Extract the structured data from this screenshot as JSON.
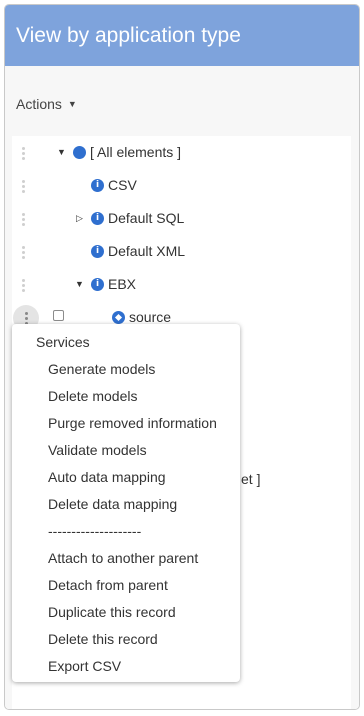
{
  "header": {
    "title": "View by application type"
  },
  "toolbar": {
    "actions_label": "Actions"
  },
  "tree": {
    "items": [
      {
        "label": "[ All elements ]"
      },
      {
        "label": "CSV"
      },
      {
        "label": "Default SQL"
      },
      {
        "label": "Default XML"
      },
      {
        "label": "EBX"
      },
      {
        "label": "source"
      }
    ],
    "partially_hidden_text": "et ]"
  },
  "context_menu": {
    "title": "Services",
    "items": [
      "Generate models",
      "Delete models",
      "Purge removed information",
      "Validate models",
      "Auto data mapping",
      "Delete data mapping",
      "--------------------",
      "Attach to another parent",
      "Detach from parent",
      "Duplicate this record",
      "Delete this record",
      "Export CSV"
    ]
  },
  "icons": {
    "drag_handle": "drag-handle-icon",
    "info": "info-icon",
    "dot": "dot-icon",
    "diamond": "diamond-icon"
  },
  "colors": {
    "header_bg": "#7ea3dc",
    "icon_blue": "#2f6fcf"
  }
}
